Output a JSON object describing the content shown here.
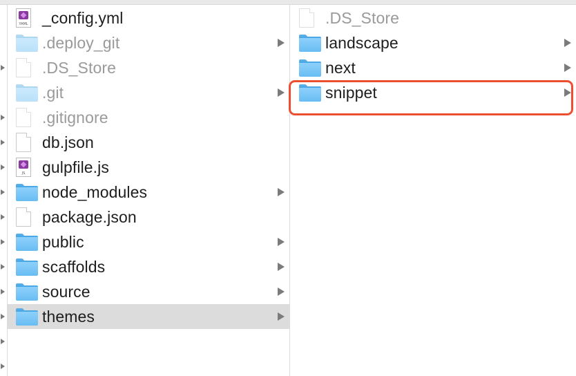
{
  "window": {
    "column1": {
      "items": [
        {
          "name": "_config.yml",
          "kind": "typed-file",
          "ext": "YAML",
          "dim": false,
          "has_children": false
        },
        {
          "name": ".deploy_git",
          "kind": "folder",
          "dim": true,
          "has_children": true
        },
        {
          "name": ".DS_Store",
          "kind": "file",
          "dim": true,
          "has_children": false
        },
        {
          "name": ".git",
          "kind": "folder",
          "dim": true,
          "has_children": true
        },
        {
          "name": ".gitignore",
          "kind": "file",
          "dim": true,
          "has_children": false
        },
        {
          "name": "db.json",
          "kind": "file",
          "dim": false,
          "has_children": false
        },
        {
          "name": "gulpfile.js",
          "kind": "typed-file",
          "ext": "JS",
          "dim": false,
          "has_children": false
        },
        {
          "name": "node_modules",
          "kind": "folder",
          "dim": false,
          "has_children": true
        },
        {
          "name": "package.json",
          "kind": "file",
          "dim": false,
          "has_children": false
        },
        {
          "name": "public",
          "kind": "folder",
          "dim": false,
          "has_children": true
        },
        {
          "name": "scaffolds",
          "kind": "folder",
          "dim": false,
          "has_children": true
        },
        {
          "name": "source",
          "kind": "folder",
          "dim": false,
          "has_children": true
        },
        {
          "name": "themes",
          "kind": "folder",
          "dim": false,
          "has_children": true,
          "selected": true
        }
      ]
    },
    "column2": {
      "items": [
        {
          "name": ".DS_Store",
          "kind": "file",
          "dim": true,
          "has_children": false
        },
        {
          "name": "landscape",
          "kind": "folder",
          "dim": false,
          "has_children": true
        },
        {
          "name": "next",
          "kind": "folder",
          "dim": false,
          "has_children": true
        },
        {
          "name": "snippet",
          "kind": "folder",
          "dim": false,
          "has_children": true,
          "highlighted": true
        }
      ]
    },
    "highlight_color": "#ec4f2f",
    "selection_color": "#dcdcdc",
    "folder_color": "#67bdf3"
  }
}
